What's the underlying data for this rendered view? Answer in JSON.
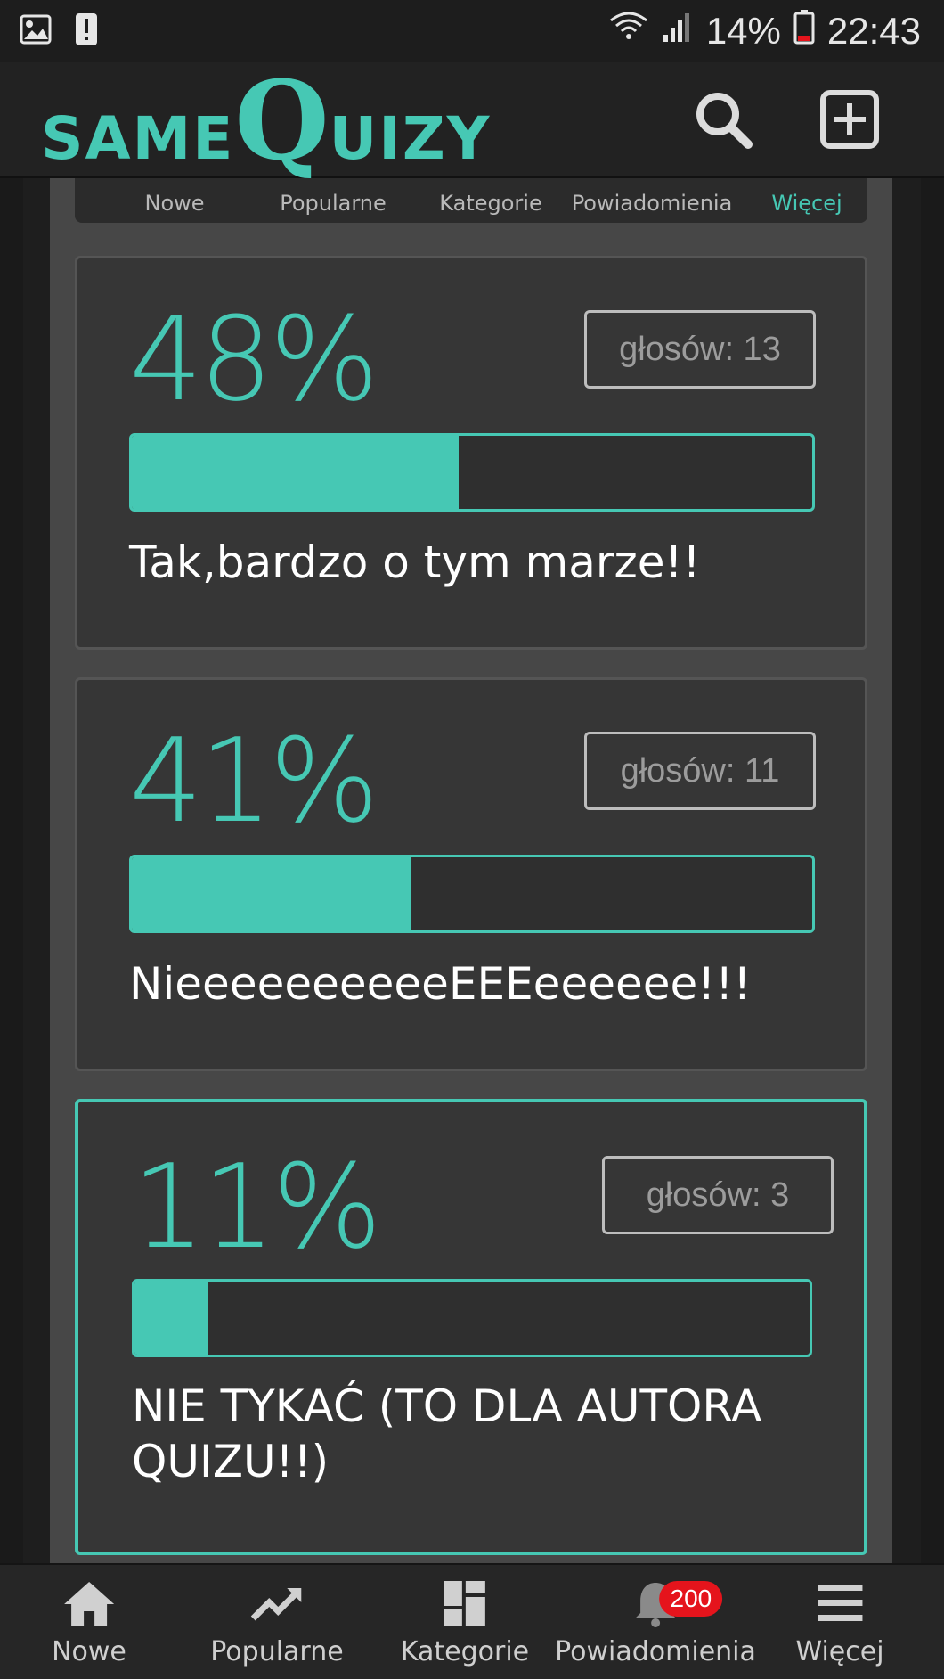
{
  "status_bar": {
    "battery_percent": "14%",
    "time": "22:43"
  },
  "header": {
    "logo_prefix": "same",
    "logo_big_letter": "Q",
    "logo_suffix": "uizy"
  },
  "top_tabs": [
    {
      "label": "Nowe"
    },
    {
      "label": "Popularne"
    },
    {
      "label": "Kategorie"
    },
    {
      "label": "Powiadomienia"
    },
    {
      "label": "Więcej"
    }
  ],
  "answers": [
    {
      "percent": "48%",
      "votes": "głosów: 13",
      "fraction": 0.48,
      "text": "Tak,bardzo o tym marze!!"
    },
    {
      "percent": "41%",
      "votes": "głosów: 11",
      "fraction": 0.41,
      "text": "NieeeeeeeeeeEEEeeeeee!!!"
    },
    {
      "percent": "11%",
      "votes": "głosów: 3",
      "fraction": 0.11,
      "text": "NIE TYKAĆ (TO DLA AUTORA QUIZU!!)"
    }
  ],
  "bottom_nav": {
    "items": [
      {
        "label": "Nowe",
        "icon": "home-icon"
      },
      {
        "label": "Popularne",
        "icon": "trending-icon"
      },
      {
        "label": "Kategorie",
        "icon": "grid-icon"
      },
      {
        "label": "Powiadomienia",
        "icon": "bell-icon",
        "badge": "200"
      },
      {
        "label": "Więcej",
        "icon": "menu-icon"
      }
    ]
  },
  "colors": {
    "accent": "#46c8b4",
    "badge": "#e5141c",
    "card": "#363636",
    "panel": "#474747"
  }
}
